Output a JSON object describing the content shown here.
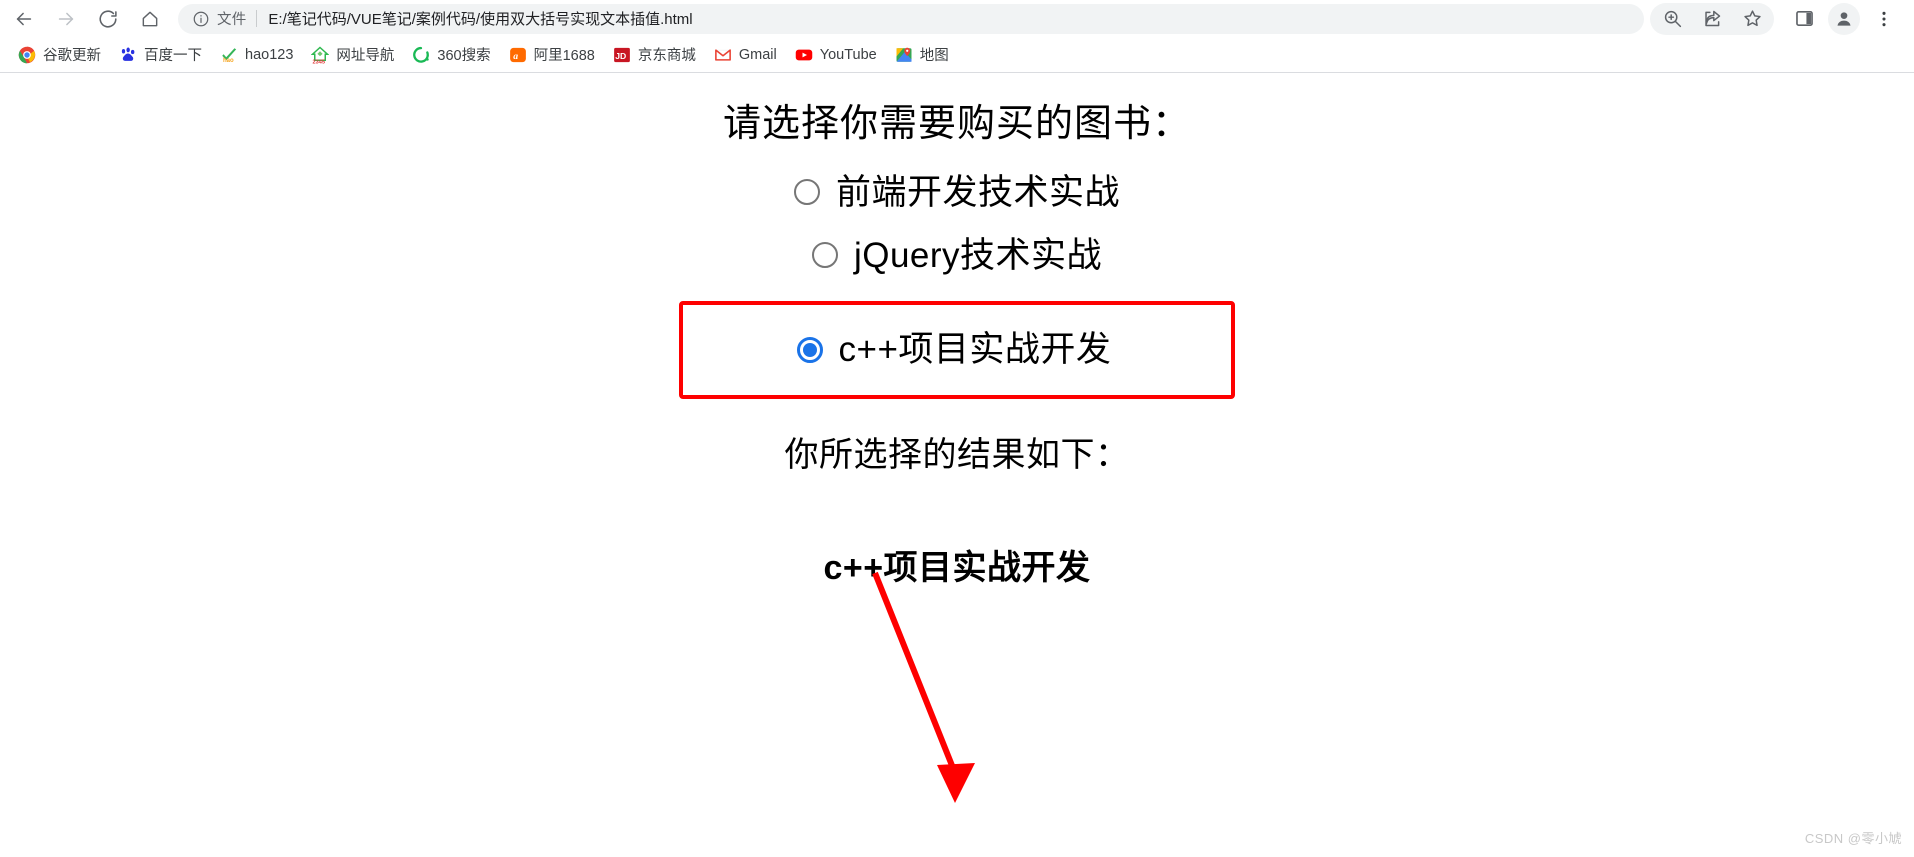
{
  "browser": {
    "nav": {
      "back_label": "Back",
      "forward_label": "Forward",
      "reload_label": "Reload",
      "home_label": "Home"
    },
    "omnibox": {
      "info_icon": "info-circle-icon",
      "scheme_label": "文件",
      "url": "E:/笔记代码/VUE笔记/案例代码/使用双大括号实现文本插值.html"
    },
    "actions": [
      {
        "name": "zoom-in-icon",
        "label": "缩放"
      },
      {
        "name": "share-icon",
        "label": "分享"
      },
      {
        "name": "bookmark-star-icon",
        "label": "收藏"
      },
      {
        "name": "side-panel-icon",
        "label": "侧边栏"
      },
      {
        "name": "profile-avatar-icon",
        "label": "个人资料"
      },
      {
        "name": "more-menu-icon",
        "label": "自定义及控制"
      }
    ],
    "bookmarks": [
      {
        "label": "谷歌更新",
        "icon": "chrome-icon"
      },
      {
        "label": "百度一下",
        "icon": "baidu-icon"
      },
      {
        "label": "hao123",
        "icon": "hao123-icon"
      },
      {
        "label": "网址导航",
        "icon": "2345-icon"
      },
      {
        "label": "360搜索",
        "icon": "so360-icon"
      },
      {
        "label": "阿里1688",
        "icon": "alibaba-icon"
      },
      {
        "label": "京东商城",
        "icon": "jd-icon"
      },
      {
        "label": "Gmail",
        "icon": "gmail-icon"
      },
      {
        "label": "YouTube",
        "icon": "youtube-icon"
      },
      {
        "label": "地图",
        "icon": "maps-icon"
      }
    ]
  },
  "page": {
    "heading": "请选择你需要购买的图书：",
    "options": [
      {
        "label": "前端开发技术实战",
        "checked": false
      },
      {
        "label": "jQuery技术实战",
        "checked": false
      },
      {
        "label": "c++项目实战开发",
        "checked": true
      }
    ],
    "result_heading": "你所选择的结果如下：",
    "result_value": "c++项目实战开发"
  },
  "annotation": {
    "box_color": "#fe0000",
    "arrow_color": "#fe0000",
    "arrow_from_label": "c++项目实战开发",
    "arrow_to_label": "c++项目实战开发"
  },
  "colors": {
    "accent_blue": "#1a73e8",
    "annotation_red": "#fe0000",
    "chrome_bg": "#ffffff",
    "omnibox_bg": "#f1f3f4",
    "text": "#202124"
  },
  "watermark": "CSDN @零小虓"
}
